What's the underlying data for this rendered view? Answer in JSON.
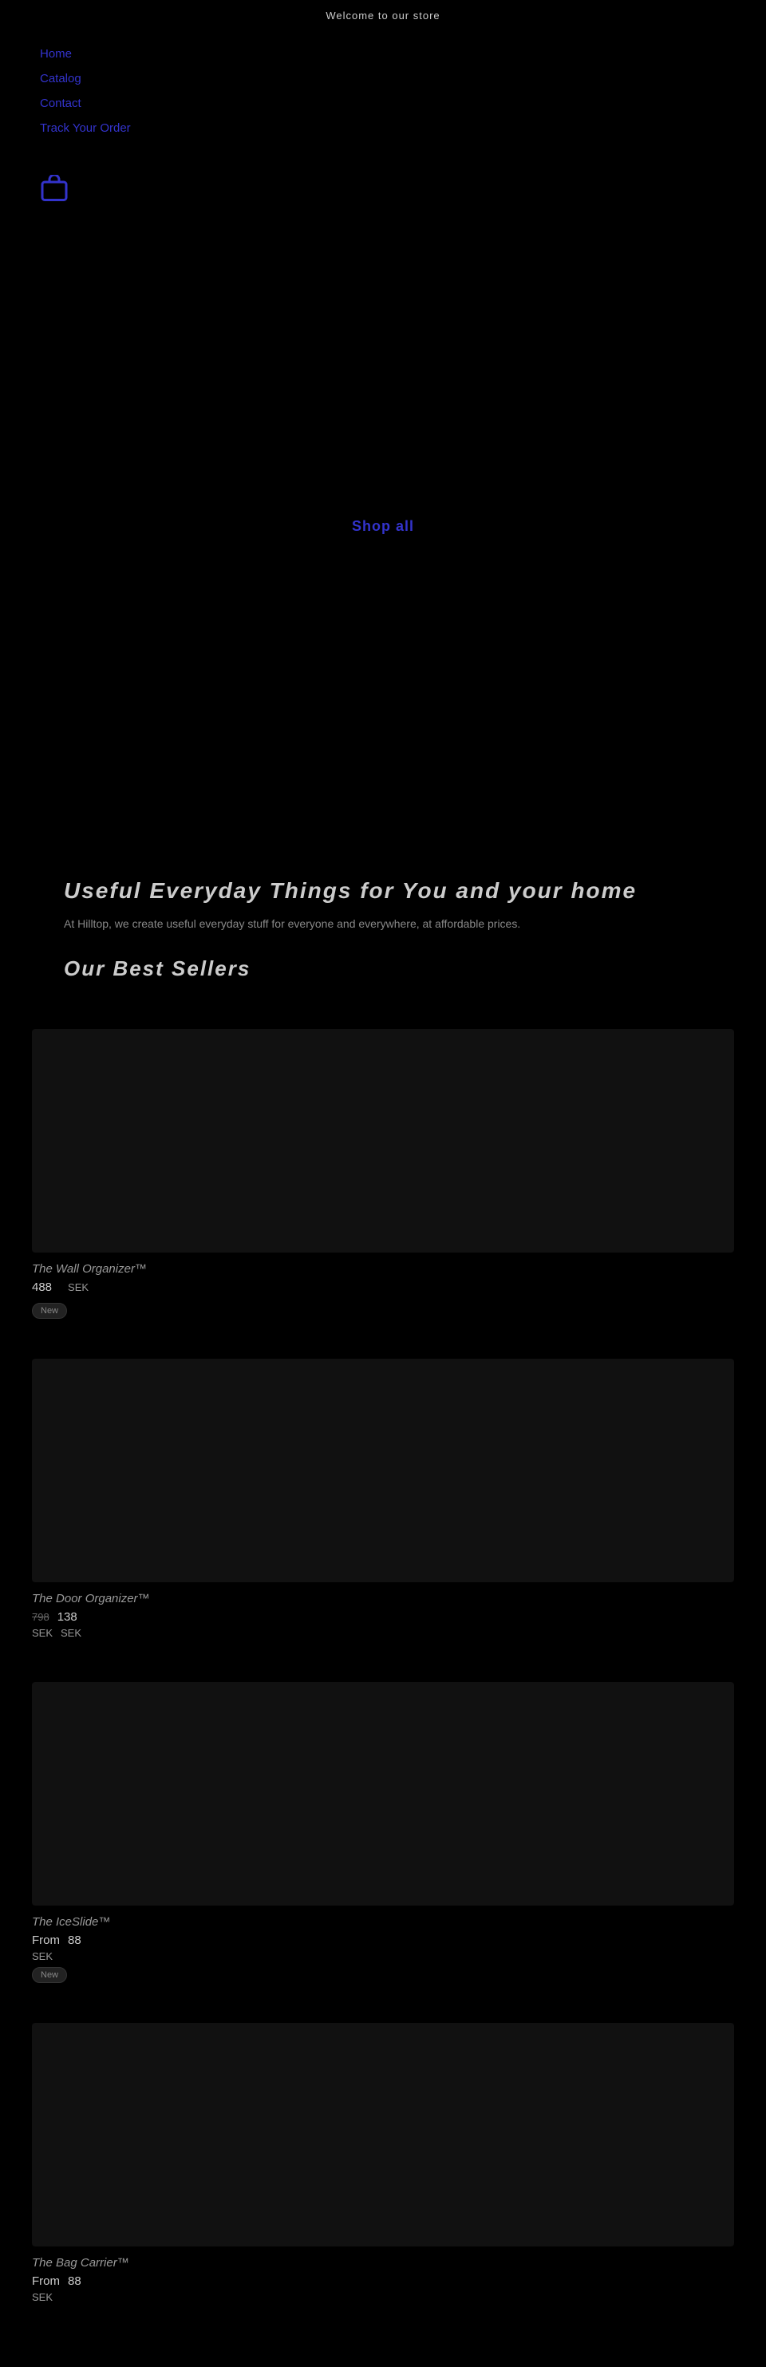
{
  "announcement": {
    "text": "Welcome to our store"
  },
  "nav": {
    "items": [
      {
        "label": "Home",
        "href": "#"
      },
      {
        "label": "Catalog",
        "href": "#"
      },
      {
        "label": "Contact",
        "href": "#"
      },
      {
        "label": "Track Your Order",
        "href": "#"
      }
    ]
  },
  "hero": {
    "shop_all_label": "Shop all"
  },
  "about": {
    "title": "Useful Everyday Things for You and your home",
    "subtitle": "At Hilltop, we create useful everyday stuff for everyone and everywhere, at affordable prices.",
    "bestsellers_title": "Our Best Sellers"
  },
  "products": [
    {
      "name": "The Wall Organizer™",
      "price": "488",
      "currency": "SEK",
      "badge": "New",
      "original_price": null,
      "from": false
    },
    {
      "name": "The Door Organizer™",
      "price": "798",
      "original_price": "138",
      "currency": "SEK",
      "badge": null,
      "from": false
    },
    {
      "name": "The IceSlide™",
      "price": "88",
      "currency": "SEK",
      "badge": "New",
      "original_price": null,
      "from": true
    },
    {
      "name": "The Bag Carrier™",
      "price": "88",
      "currency": "SEK",
      "badge": null,
      "original_price": null,
      "from": true
    }
  ],
  "icons": {
    "cart": "shopping-bag-icon"
  }
}
